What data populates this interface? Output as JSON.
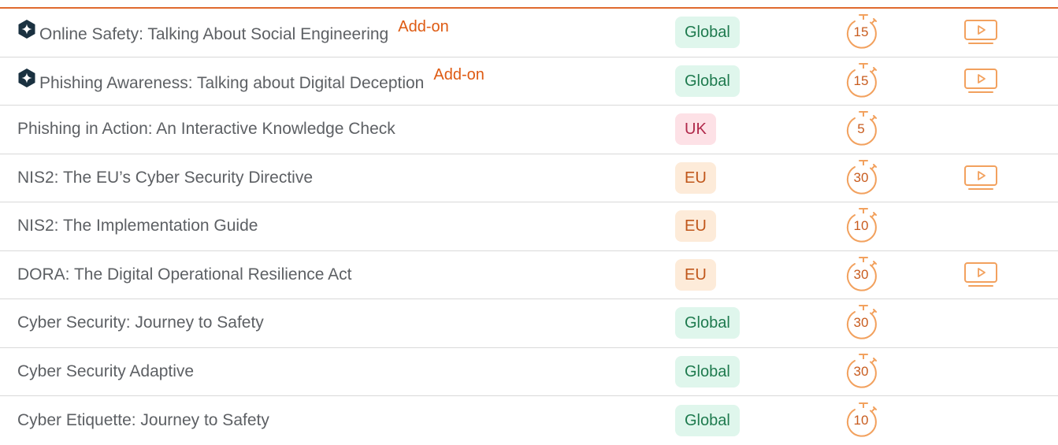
{
  "colors": {
    "accent": "#de5a12",
    "global_bg": "#dff6ec",
    "global_text": "#1e7a4e",
    "uk_bg": "#fde1e6",
    "uk_text": "#b0284a",
    "eu_bg": "#fdebd9",
    "eu_text": "#c0571b",
    "icon_orange": "#f2a15e",
    "brand_icon": "#1a3140"
  },
  "icons": {
    "brand": "star-badge-icon",
    "duration": "stopwatch-icon",
    "video": "video-play-icon"
  },
  "courses": [
    {
      "title": "Online Safety: Talking About Social Engineering",
      "addon": "Add-on",
      "brand_icon": true,
      "region": "Global",
      "duration": "15",
      "video": true
    },
    {
      "title": "Phishing Awareness: Talking about Digital Deception",
      "addon": "Add-on",
      "brand_icon": true,
      "region": "Global",
      "duration": "15",
      "video": true
    },
    {
      "title": "Phishing in Action: An Interactive Knowledge Check",
      "addon": "",
      "brand_icon": false,
      "region": "UK",
      "duration": "5",
      "video": false
    },
    {
      "title": "NIS2: The EU’s Cyber Security Directive",
      "addon": "",
      "brand_icon": false,
      "region": "EU",
      "duration": "30",
      "video": true
    },
    {
      "title": "NIS2: The Implementation Guide",
      "addon": "",
      "brand_icon": false,
      "region": "EU",
      "duration": "10",
      "video": false
    },
    {
      "title": "DORA: The Digital Operational Resilience Act",
      "addon": "",
      "brand_icon": false,
      "region": "EU",
      "duration": "30",
      "video": true
    },
    {
      "title": "Cyber Security: Journey to Safety",
      "addon": "",
      "brand_icon": false,
      "region": "Global",
      "duration": "30",
      "video": false
    },
    {
      "title": "Cyber Security Adaptive",
      "addon": "",
      "brand_icon": false,
      "region": "Global",
      "duration": "30",
      "video": false
    },
    {
      "title": "Cyber Etiquette: Journey to Safety",
      "addon": "",
      "brand_icon": false,
      "region": "Global",
      "duration": "10",
      "video": false
    }
  ]
}
